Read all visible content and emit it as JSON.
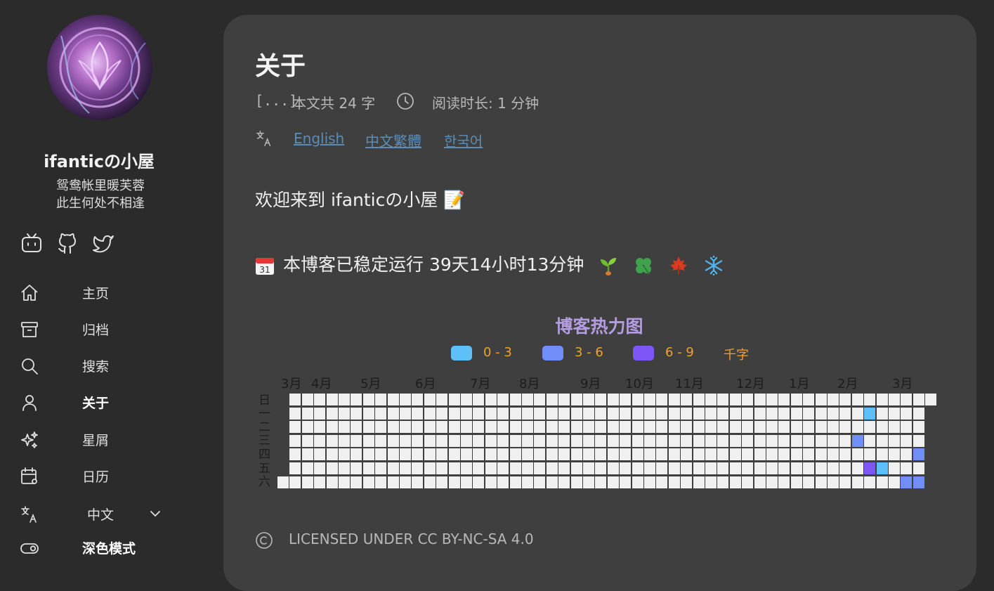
{
  "sidebar": {
    "site_title": "ifanticの小屋",
    "motto_line1": "鸳鸯帐里暖芙蓉",
    "motto_line2": "此生何处不相逢",
    "social": [
      "bilibili-icon",
      "github-icon",
      "twitter-icon"
    ],
    "nav": [
      {
        "icon": "home-icon",
        "label": "主页"
      },
      {
        "icon": "archive-icon",
        "label": "归档"
      },
      {
        "icon": "search-icon",
        "label": "搜索"
      },
      {
        "icon": "user-icon",
        "label": "关于",
        "active": true
      },
      {
        "icon": "sparkles-icon",
        "label": "星屑"
      },
      {
        "icon": "calendar-icon",
        "label": "日历"
      },
      {
        "icon": "translate-icon",
        "label": "中文"
      },
      {
        "icon": "toggle-icon",
        "label": "深色模式"
      }
    ]
  },
  "article": {
    "title": "关于",
    "word_count_icon": "brackets-icon",
    "word_count": "本文共 24 字",
    "reading_icon": "clock-icon",
    "reading_time": "阅读时长: 1 分钟",
    "languages": [
      "English",
      "中文繁體",
      "한국어"
    ],
    "welcome": "欢迎来到 ifanticの小屋 📝",
    "runtime_text": "本博客已稳定运行 39天14小时13分钟",
    "runtime_emojis": [
      "seedling",
      "clover",
      "maple-leaf",
      "snowflake"
    ],
    "footer": "LICENSED UNDER CC BY-NC-SA 4.0"
  },
  "heatmap": {
    "title": "博客热力图",
    "legend": [
      {
        "label": "0 - 3",
        "color": "#5ec0f8"
      },
      {
        "label": "3 - 6",
        "color": "#6f8ef8"
      },
      {
        "label": "6 - 9",
        "color": "#7e55f7"
      },
      {
        "label": "千字",
        "color": null
      }
    ],
    "months": [
      "3月",
      "4月",
      "5月",
      "6月",
      "7月",
      "8月",
      "9月",
      "10月",
      "11月",
      "12月",
      "1月",
      "2月",
      "3月"
    ],
    "weekdays": [
      "日",
      "一",
      "二",
      "三",
      "四",
      "五",
      "六"
    ],
    "empty_color": "#f0f0f0",
    "active_cells": [
      {
        "week": 48,
        "day": 1,
        "level": 1
      },
      {
        "week": 47,
        "day": 3,
        "level": 2
      },
      {
        "week": 52,
        "day": 4,
        "level": 2
      },
      {
        "week": 48,
        "day": 5,
        "level": 3
      },
      {
        "week": 49,
        "day": 5,
        "level": 1
      },
      {
        "week": 51,
        "day": 6,
        "level": 2
      },
      {
        "week": 52,
        "day": 6,
        "level": 2
      }
    ]
  }
}
